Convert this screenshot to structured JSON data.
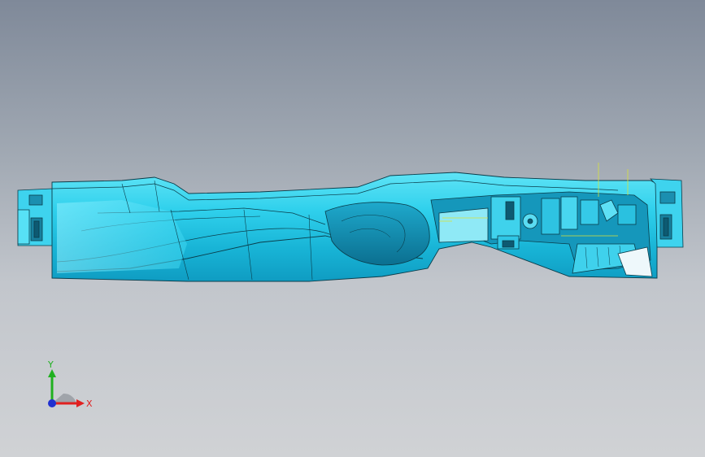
{
  "viewport": {
    "background_top": "#7f8999",
    "background_bottom": "#d0d2d5",
    "model_color": "#2ec8e6",
    "model_edge_color": "#0a3c4a",
    "dimension_color": "#d8e23a"
  },
  "triad": {
    "x_label": "X",
    "y_label": "Y",
    "x_color": "#e02020",
    "y_color": "#20b020",
    "z_color": "#2030d0"
  }
}
